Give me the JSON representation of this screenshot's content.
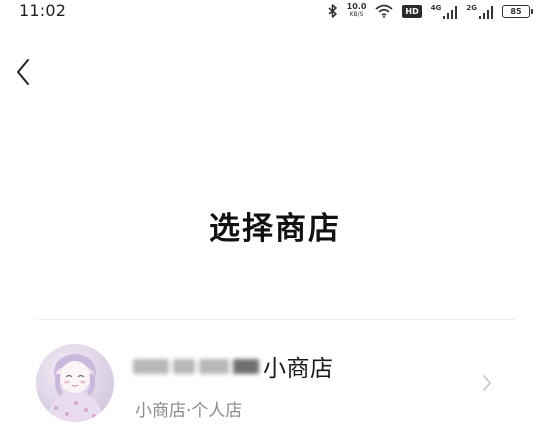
{
  "status_bar": {
    "time": "11:02",
    "network_speed_value": "10.0",
    "network_speed_unit": "KB/S",
    "hd_label": "HD",
    "sim1_type": "4G",
    "sim2_type": "2G",
    "battery_level": "85",
    "icons": [
      "bluetooth-icon",
      "wifi-icon",
      "signal-icon",
      "battery-icon"
    ]
  },
  "header": {
    "back_icon": "chevron-left-icon"
  },
  "page": {
    "title": "选择商店"
  },
  "stores": [
    {
      "name_visible_suffix": "小商店",
      "subtitle": "小商店·个人店",
      "chevron_icon": "chevron-right-icon"
    }
  ],
  "colors": {
    "background": "#ffffff",
    "title_text": "#111111",
    "subtitle_text": "#8c8c8c",
    "divider": "#ececec",
    "chevron": "#c4c4c4"
  }
}
